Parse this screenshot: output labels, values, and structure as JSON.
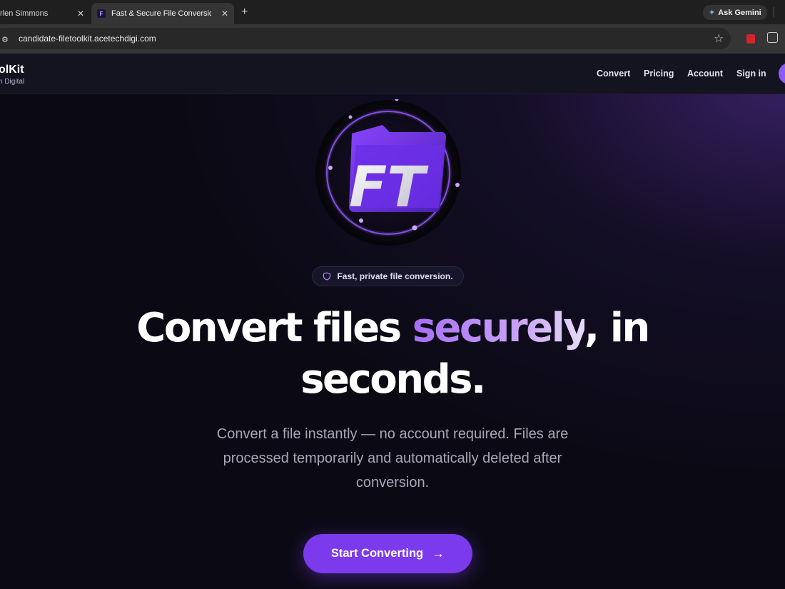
{
  "browser": {
    "tabs": [
      {
        "title": "rlen Simmons"
      },
      {
        "title": "Fast & Secure File Conversion –"
      }
    ],
    "url": "candidate-filetoolkit.acetechdigi.com",
    "gemini_label": "Ask Gemini",
    "favicon_letter": "F",
    "close_glyph": "✕",
    "newtab_glyph": "+"
  },
  "nav": {
    "brand": "olKit",
    "brand_sub": "n Digital",
    "links": [
      "Convert",
      "Pricing",
      "Account",
      "Sign in"
    ]
  },
  "hero": {
    "logo_text": "FT",
    "badge": "Fast, private file conversion.",
    "headline_part1": "Convert files ",
    "headline_accent": "securely",
    "headline_part2": ", in",
    "headline_line2": "seconds.",
    "subtext_lines": [
      "Convert a file instantly — no account required. Files are",
      "processed temporarily and automatically deleted after",
      "conversion."
    ],
    "cta_label": "Start Converting",
    "cta_arrow": "→"
  },
  "colors": {
    "accent": "#7c3aed",
    "accent_light": "#a66df7",
    "background": "#0b0a14"
  }
}
